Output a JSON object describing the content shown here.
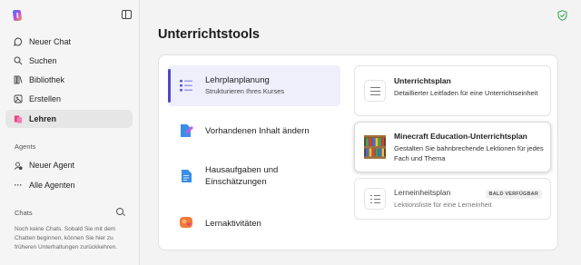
{
  "sidebar": {
    "nav": [
      {
        "label": "Neuer Chat",
        "icon": "chat-bubble-icon"
      },
      {
        "label": "Suchen",
        "icon": "search-icon"
      },
      {
        "label": "Bibliothek",
        "icon": "library-icon"
      },
      {
        "label": "Erstellen",
        "icon": "create-icon"
      },
      {
        "label": "Lehren",
        "icon": "teach-icon",
        "active": true
      }
    ],
    "agents_label": "Agents",
    "agents": [
      {
        "label": "Neuer Agent",
        "icon": "new-agent-icon"
      },
      {
        "label": "Alle Agenten",
        "icon": "more-icon"
      }
    ],
    "chats_label": "Chats",
    "chats_empty": "Noch keine Chats. Sobald Sie mit dem Chatten beginnen, können Sie hier zu früheren Unterhaltungen zurückkehren."
  },
  "main": {
    "title": "Unterrichtstools",
    "tools": [
      {
        "title": "Lehrplanplanung",
        "subtitle": "Strukturieren Ihres Kurses",
        "icon": "curriculum-list-icon",
        "selected": true
      },
      {
        "title": "Vorhandenen Inhalt ändern",
        "icon": "edit-content-icon"
      },
      {
        "title": "Hausaufgaben und Einschätzungen",
        "icon": "document-icon"
      },
      {
        "title": "Lernaktivitäten",
        "icon": "activity-icon"
      }
    ],
    "plans": [
      {
        "title": "Unterrichtsplan",
        "subtitle": "Detaillierter Leitfaden für eine Unterrichtseinheit",
        "icon": "list-icon"
      },
      {
        "title": "Minecraft Education-Unterrichtsplan",
        "subtitle": "Gestalten Sie bahnbrechende Lektionen für jedes Fach und Thema",
        "icon": "minecraft-bookshelf-icon"
      },
      {
        "title": "Lerneinheitsplan",
        "subtitle": "Lektionsliste für eine Lerneinheit",
        "icon": "checklist-icon",
        "badge": "BALD VERFÜGBAR"
      }
    ]
  },
  "colors": {
    "accent": "#4f46c7",
    "selected_bg": "#efeefb",
    "shield": "#2e9e4f"
  }
}
